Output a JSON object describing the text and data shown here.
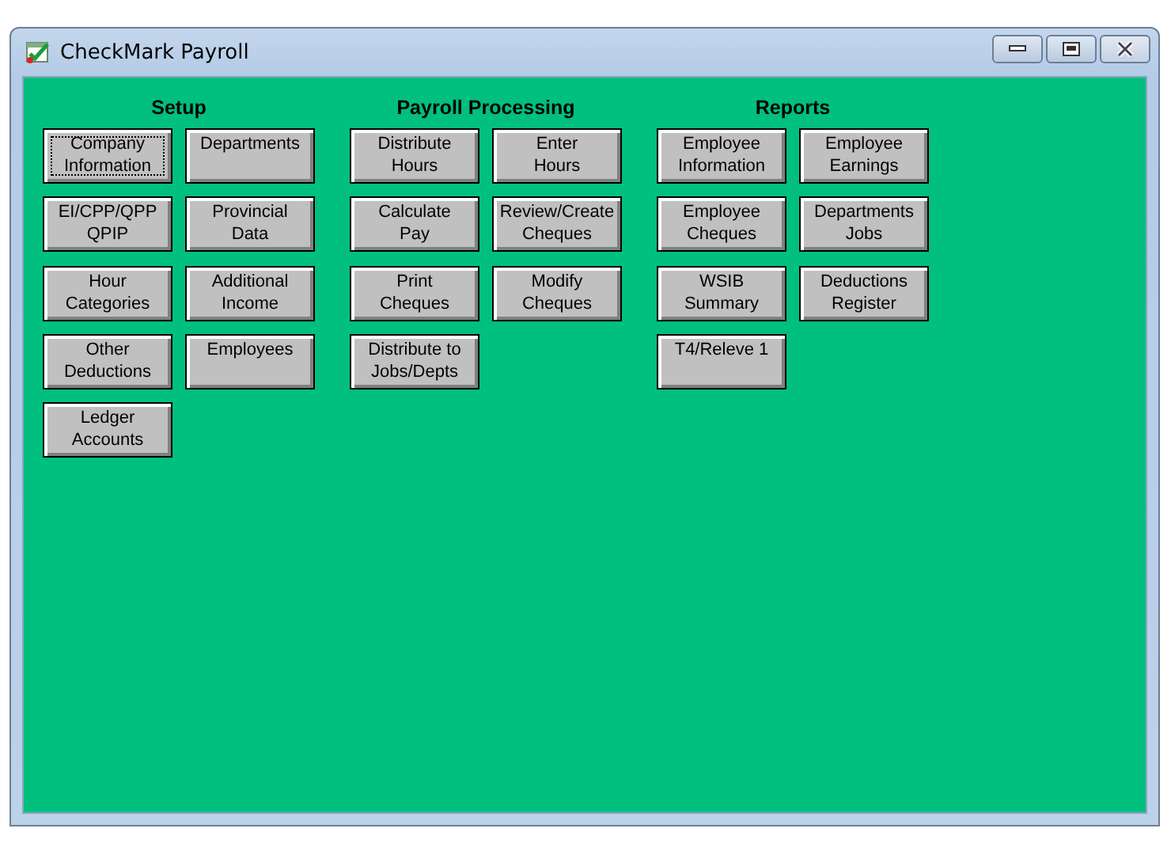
{
  "window": {
    "title": "CheckMark Payroll"
  },
  "sections": [
    {
      "heading": "Setup",
      "buttons": [
        {
          "label": "Company\nInformation",
          "focused": true
        },
        {
          "label": "Departments",
          "focused": false
        },
        {
          "label": "EI/CPP/QPP\nQPIP",
          "focused": false
        },
        {
          "label": "Provincial\nData",
          "focused": false
        },
        {
          "label": "Hour\nCategories",
          "focused": false
        },
        {
          "label": "Additional\nIncome",
          "focused": false
        },
        {
          "label": "Other\nDeductions",
          "focused": false
        },
        {
          "label": "Employees",
          "focused": false
        },
        {
          "label": "Ledger\nAccounts",
          "focused": false
        }
      ]
    },
    {
      "heading": "Payroll Processing",
      "buttons": [
        {
          "label": "Distribute\nHours",
          "focused": false
        },
        {
          "label": "Enter\nHours",
          "focused": false
        },
        {
          "label": "Calculate\nPay",
          "focused": false
        },
        {
          "label": "Review/Create\nCheques",
          "focused": false
        },
        {
          "label": "Print\nCheques",
          "focused": false
        },
        {
          "label": "Modify\nCheques",
          "focused": false
        },
        {
          "label": "Distribute to\nJobs/Depts",
          "focused": false
        }
      ]
    },
    {
      "heading": "Reports",
      "buttons": [
        {
          "label": "Employee\nInformation",
          "focused": false
        },
        {
          "label": "Employee\nEarnings",
          "focused": false
        },
        {
          "label": "Employee\nCheques",
          "focused": false
        },
        {
          "label": "Departments\nJobs",
          "focused": false
        },
        {
          "label": "WSIB\nSummary",
          "focused": false
        },
        {
          "label": "Deductions\nRegister",
          "focused": false
        },
        {
          "label": "T4/Releve 1",
          "focused": false
        }
      ]
    }
  ]
}
